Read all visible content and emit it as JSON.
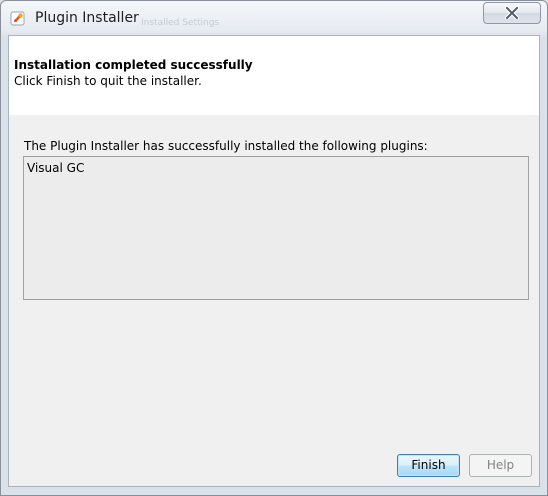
{
  "window": {
    "title": "Plugin Installer",
    "app_icon": "netbeans-plugin-icon",
    "close_icon": "close-icon",
    "background_tabs": "Installed   Settings"
  },
  "header": {
    "title": "Installation completed successfully",
    "subtitle": "Click Finish to quit the installer."
  },
  "content": {
    "label": "The Plugin Installer has successfully installed the following plugins:",
    "plugins": [
      "Visual GC"
    ]
  },
  "buttons": {
    "finish": "Finish",
    "help": "Help",
    "help_enabled": false
  },
  "colors": {
    "header_bg": "#ffffff",
    "body_bg": "#f0f0f0",
    "default_button_border": "#3c7fb1",
    "disabled_text": "#838383"
  }
}
